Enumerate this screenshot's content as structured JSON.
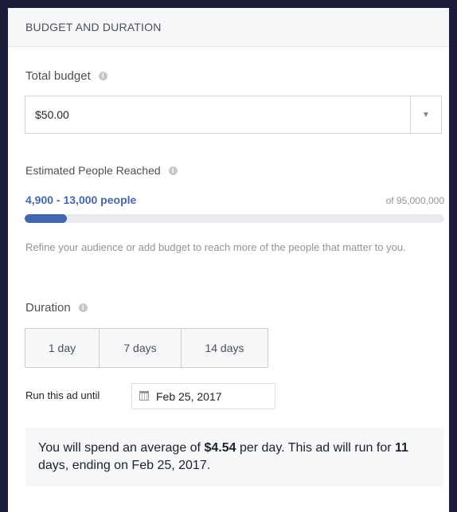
{
  "header": {
    "title": "BUDGET AND DURATION"
  },
  "budget": {
    "label": "Total budget",
    "value": "$50.00",
    "info_icon": "info-icon",
    "dropdown_icon": "chevron-down-icon"
  },
  "reach": {
    "label": "Estimated People Reached",
    "range": "4,900 - 13,000 people",
    "total": "of 95,000,000",
    "fill_fraction": 0.1,
    "bar_color": "#4267b2",
    "note": "Refine your audience or add budget to reach more of the people that matter to you."
  },
  "duration": {
    "label": "Duration",
    "options": [
      "1 day",
      "7 days",
      "14 days"
    ],
    "run_until_label": "Run this ad until",
    "end_date": "Feb 25, 2017"
  },
  "summary": {
    "prefix": "You will spend an average of ",
    "amount": "$4.54",
    "middle": " per day. This ad will run for ",
    "days": "11",
    "suffix": " days, ending on Feb 25, 2017."
  },
  "colors": {
    "accent": "#4267b2",
    "background": "#1c1d3a"
  }
}
